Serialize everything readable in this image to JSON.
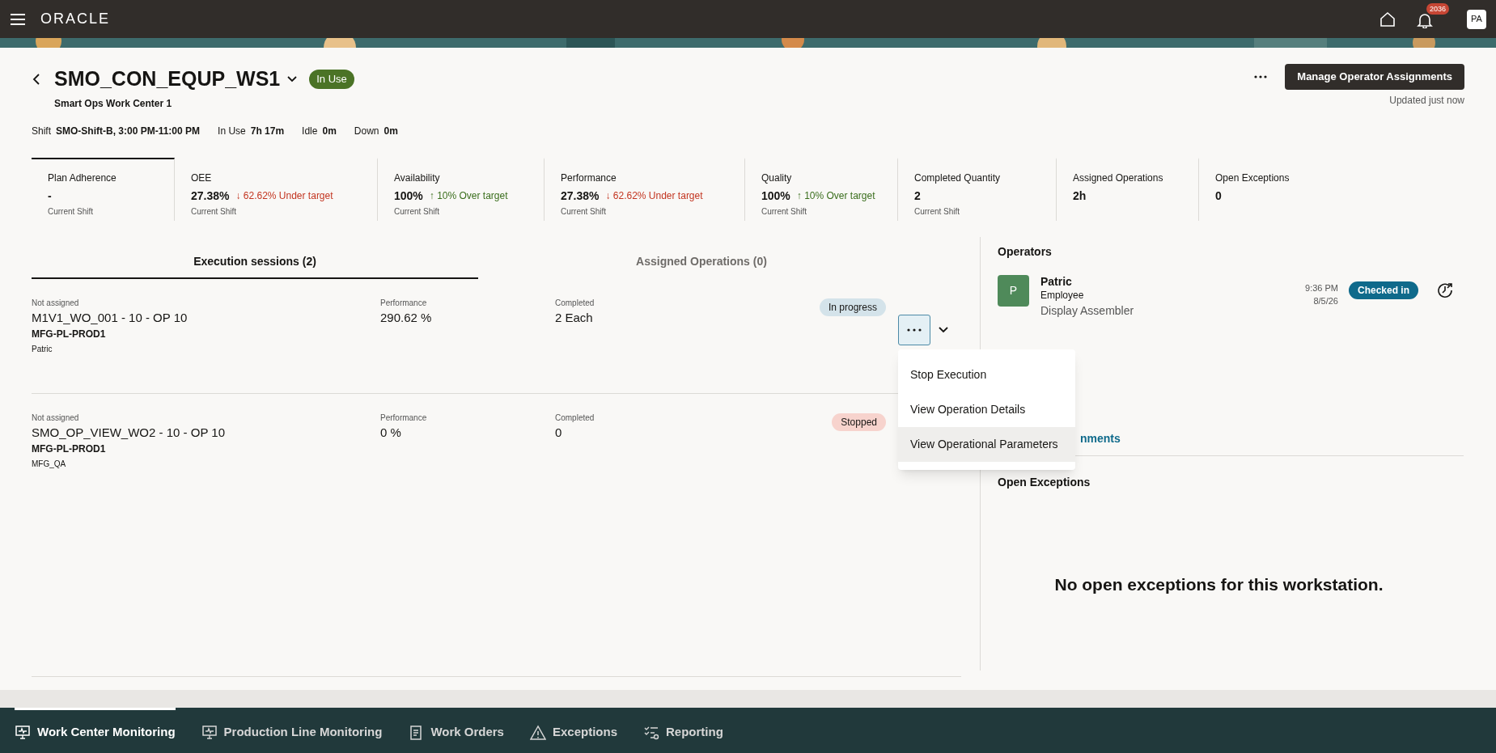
{
  "header": {
    "brand": "ORACLE",
    "notification_count": "2036",
    "user_initials": "PA"
  },
  "workstation": {
    "name": "SMO_CON_EQUP_WS1",
    "status": "In Use",
    "description": "Smart Ops Work Center 1",
    "shift_label": "Shift",
    "shift": "SMO-Shift-B, 3:00 PM-11:00 PM",
    "times": [
      {
        "label": "In Use",
        "value": "7h 17m"
      },
      {
        "label": "Idle",
        "value": "0m"
      },
      {
        "label": "Down",
        "value": "0m"
      }
    ],
    "button": "Manage Operator Assignments",
    "updated": "Updated just now"
  },
  "kpis": [
    {
      "label": "Plan Adherence",
      "value": "-",
      "subtext": "Current Shift",
      "selected": true
    },
    {
      "label": "OEE",
      "value": "27.38%",
      "delta": "↓ 62.62% Under target",
      "kind": "down",
      "subtext": "Current Shift",
      "selected": false
    },
    {
      "label": "Availability",
      "value": "100%",
      "delta": "↑ 10% Over target",
      "kind": "up",
      "subtext": "Current Shift",
      "selected": false
    },
    {
      "label": "Performance",
      "value": "27.38%",
      "delta": "↓ 62.62% Under target",
      "kind": "down",
      "subtext": "Current Shift",
      "selected": false
    },
    {
      "label": "Quality",
      "value": "100%",
      "delta": "↑ 10% Over target",
      "kind": "up",
      "subtext": "Current Shift",
      "selected": false
    },
    {
      "label": "Completed Quantity",
      "value": "2",
      "subtext": "Current Shift",
      "selected": false
    },
    {
      "label": "Assigned Operations",
      "value": "2h",
      "selected": false
    },
    {
      "label": "Open Exceptions",
      "value": "0",
      "selected": false
    }
  ],
  "tabs": [
    {
      "label": "Execution sessions (2)",
      "selected": true
    },
    {
      "label": "Assigned Operations (0)",
      "selected": false
    }
  ],
  "sessions": [
    {
      "assignment": "Not assigned",
      "operation": "M1V1_WO_001 - 10 - OP 10",
      "line": "MFG-PL-PROD1",
      "operator": "Patric",
      "performance_label": "Performance",
      "performance": "290.62 %",
      "completed_label": "Completed",
      "completed": "2 Each",
      "status": "In progress",
      "kind": "progress",
      "menu_open": true
    },
    {
      "assignment": "Not assigned",
      "operation": "SMO_OP_VIEW_WO2 - 10 - OP 10",
      "line": "MFG-PL-PROD1",
      "operator": "MFG_QA",
      "performance_label": "Performance",
      "performance": "0 %",
      "completed_label": "Completed",
      "completed": "0",
      "status": "Stopped",
      "kind": "stopped",
      "menu_open": false
    }
  ],
  "menu": [
    {
      "label": "Stop Execution",
      "hovered": false
    },
    {
      "label": "View Operation Details",
      "hovered": false
    },
    {
      "label": "View Operational Parameters",
      "hovered": true
    }
  ],
  "operators": {
    "title": "Operators",
    "items": [
      {
        "initial": "P",
        "name": "Patric",
        "role": "Employee",
        "job": "Display Assembler",
        "time": "9:36 PM",
        "date": "8/5/26",
        "status": "Checked in"
      }
    ],
    "link": "nments"
  },
  "exceptions": {
    "title": "Open Exceptions",
    "empty_message": "No open exceptions for this workstation."
  },
  "bottom_nav": [
    {
      "label": "Work Center Monitoring",
      "kind": "monitor",
      "selected": true
    },
    {
      "label": "Production Line Monitoring",
      "kind": "monitor",
      "selected": false
    },
    {
      "label": "Work Orders",
      "kind": "document",
      "selected": false
    },
    {
      "label": "Exceptions",
      "kind": "warning",
      "selected": false
    },
    {
      "label": "Reporting",
      "kind": "checklist",
      "selected": false
    }
  ]
}
